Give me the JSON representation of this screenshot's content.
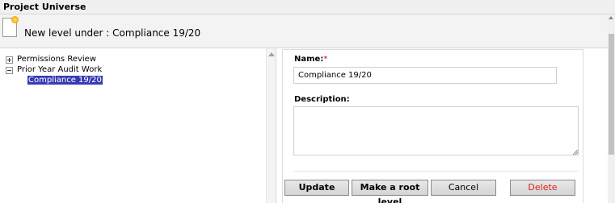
{
  "window": {
    "title": "Project Universe"
  },
  "header": {
    "heading": "New level under : Compliance 19/20"
  },
  "tree": {
    "items": [
      {
        "label": "Permissions Review",
        "state": "collapsed"
      },
      {
        "label": "Prior Year Audit Work",
        "state": "expanded"
      },
      {
        "label": "Compliance 19/20",
        "state": "selected"
      }
    ]
  },
  "form": {
    "name_label": "Name:",
    "required_marker": "*",
    "name_value": "Compliance 19/20",
    "description_label": "Description:",
    "description_value": ""
  },
  "actions": {
    "update_label": "Update",
    "make_root_label": "Make a root level",
    "cancel_label": "Cancel",
    "delete_label": "Delete"
  },
  "colors": {
    "selection": "#3a3ab4",
    "required": "#dd0000",
    "delete_text": "#e02020"
  }
}
